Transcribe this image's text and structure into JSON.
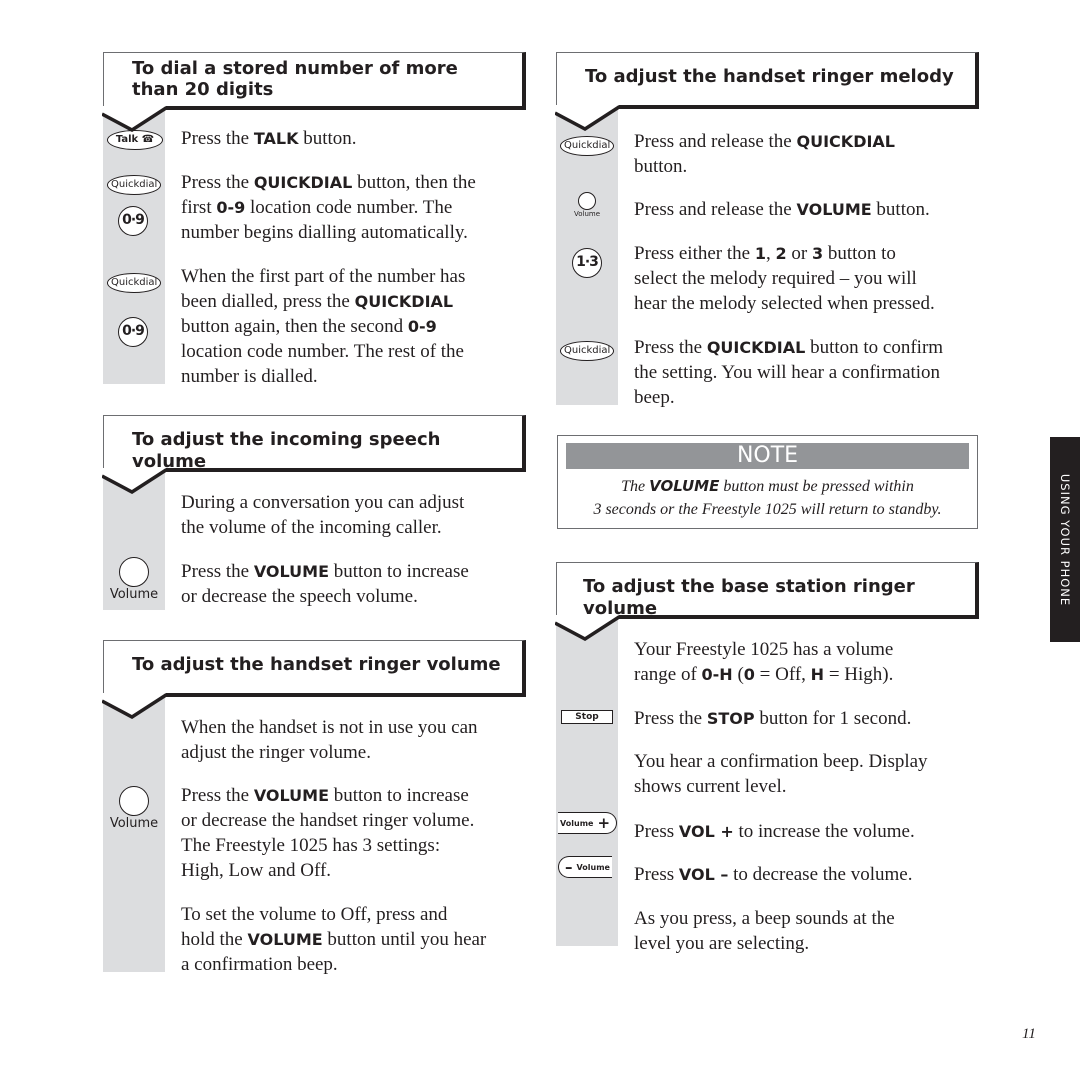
{
  "page": {
    "side_tab": "USING YOUR PHONE",
    "page_number": "11"
  },
  "sections": {
    "dial_stored": {
      "title_line1": "To dial a stored number of more",
      "title_line2": "than 20 digits",
      "icons": {
        "talk": "Talk",
        "quickdial": "Quickdial",
        "digits": "0·9"
      },
      "step1": {
        "pre": "Press the ",
        "bold": "TALK",
        "post": " button."
      },
      "step2": {
        "l1_pre": "Press the ",
        "l1_bold": "QUICKDIAL",
        "l1_post": " button, then the",
        "l2_pre": "first ",
        "l2_bold": "0-9",
        "l2_post": " location code number. The",
        "l3": "number begins dialling automatically."
      },
      "step3": {
        "l1": "When the first part of the number has",
        "l2_pre": "been dialled, press the ",
        "l2_bold": "QUICKDIAL",
        "l3_pre": "button again, then the second ",
        "l3_bold": "0-9",
        "l4": "location code number. The rest of the",
        "l5": "number is dialled."
      }
    },
    "speech_volume": {
      "title": "To adjust the incoming speech volume",
      "icon_label": "Volume",
      "p1_l1": "During a conversation you can adjust",
      "p1_l2": "the volume of the incoming caller.",
      "p2_l1_pre": "Press the ",
      "p2_l1_bold": "VOLUME",
      "p2_l1_post": " button to increase",
      "p2_l2": "or decrease the speech volume."
    },
    "handset_volume": {
      "title": "To adjust the handset ringer volume",
      "icon_label": "Volume",
      "p1_l1": "When the handset is not in use you can",
      "p1_l2": "adjust the ringer volume.",
      "p2_l1_pre": "Press the ",
      "p2_l1_bold": "VOLUME",
      "p2_l1_post": " button to increase",
      "p2_l2": "or decrease the handset ringer volume.",
      "p2_l3": "The Freestyle 1025 has 3 settings:",
      "p2_l4": "High, Low and Off.",
      "p3_l1": "To set the volume to Off, press and",
      "p3_l2_pre": "hold the ",
      "p3_l2_bold": "VOLUME",
      "p3_l2_post": " button until you hear",
      "p3_l3": "a confirmation beep."
    },
    "ringer_melody": {
      "title": "To adjust the handset ringer melody",
      "icons": {
        "quickdial": "Quickdial",
        "volume": "Volume",
        "digits": "1·3"
      },
      "s1_l1_pre": "Press and release the ",
      "s1_l1_bold": "QUICKDIAL",
      "s1_l2": "button.",
      "s2_pre": "Press and release the ",
      "s2_bold": "VOLUME",
      "s2_post": " button.",
      "s3_l1_pre": "Press either the ",
      "s3_b1": "1",
      "s3_sep1": ", ",
      "s3_b2": "2",
      "s3_sep2": " or ",
      "s3_b3": "3",
      "s3_l1_post": " button to",
      "s3_l2": "select the melody required – you will",
      "s3_l3": "hear the melody selected when pressed.",
      "s4_l1_pre": "Press the ",
      "s4_l1_bold": "QUICKDIAL",
      "s4_l1_post": " button to confirm",
      "s4_l2": "the setting. You will hear a confirmation",
      "s4_l3": "beep."
    },
    "note": {
      "title": "NOTE",
      "l1_pre": "The ",
      "l1_bold": "VOLUME",
      "l1_post": " button must be pressed within",
      "l2": "3 seconds or the Freestyle 1025 will return to standby."
    },
    "base_volume": {
      "title": "To adjust the base station ringer volume",
      "icons": {
        "stop": "Stop",
        "vol_plus_label": "Volume",
        "vol_plus_sym": "+",
        "vol_minus_label": "Volume",
        "vol_minus_sym": "–"
      },
      "p1_l1": "Your Freestyle 1025 has a volume",
      "p1_l2_pre": "range of ",
      "p1_l2_b1": "0-H",
      "p1_l2_mid1": " (",
      "p1_l2_b2": "0",
      "p1_l2_mid2": " = Off, ",
      "p1_l2_b3": "H",
      "p1_l2_post": " = High).",
      "p2_pre": "Press the ",
      "p2_bold": "STOP",
      "p2_post": " button for 1 second.",
      "p3_l1": "You hear a confirmation beep. Display",
      "p3_l2": "shows current level.",
      "p4_pre": "Press ",
      "p4_bold": "VOL +",
      "p4_post": " to increase the volume.",
      "p5_pre": "Press ",
      "p5_bold": "VOL –",
      "p5_post": " to decrease the volume.",
      "p6_l1": "As you press, a beep sounds at the",
      "p6_l2": "level you are selecting."
    }
  }
}
